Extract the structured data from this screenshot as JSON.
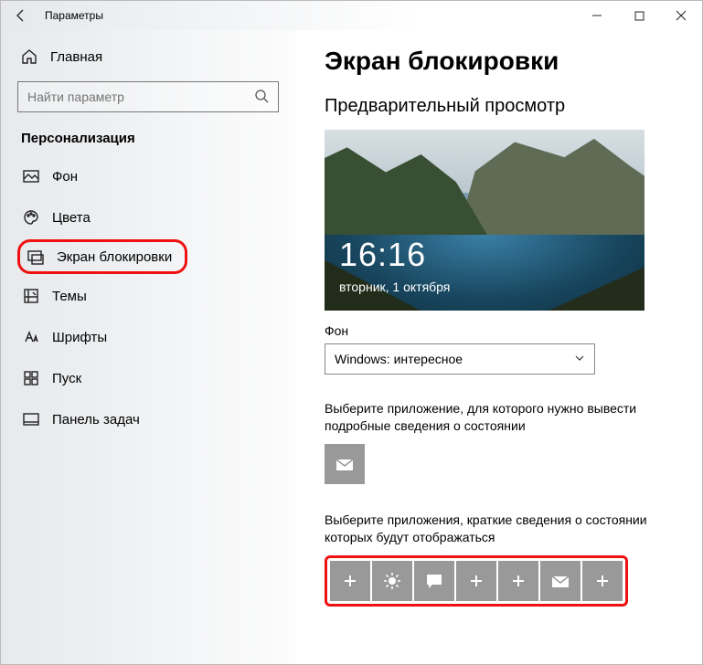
{
  "window": {
    "title": "Параметры"
  },
  "sidebar": {
    "home": "Главная",
    "search_placeholder": "Найти параметр",
    "category": "Персонализация",
    "items": [
      {
        "label": "Фон"
      },
      {
        "label": "Цвета"
      },
      {
        "label": "Экран блокировки"
      },
      {
        "label": "Темы"
      },
      {
        "label": "Шрифты"
      },
      {
        "label": "Пуск"
      },
      {
        "label": "Панель задач"
      }
    ]
  },
  "main": {
    "title": "Экран блокировки",
    "preview_header": "Предварительный просмотр",
    "preview_time": "16:16",
    "preview_date": "вторник, 1 октября",
    "background_label": "Фон",
    "background_value": "Windows: интересное",
    "detail_app_text": "Выберите приложение, для которого нужно вывести подробные сведения о состоянии",
    "quick_apps_text": "Выберите приложения, краткие сведения о состоянии которых будут отображаться"
  }
}
